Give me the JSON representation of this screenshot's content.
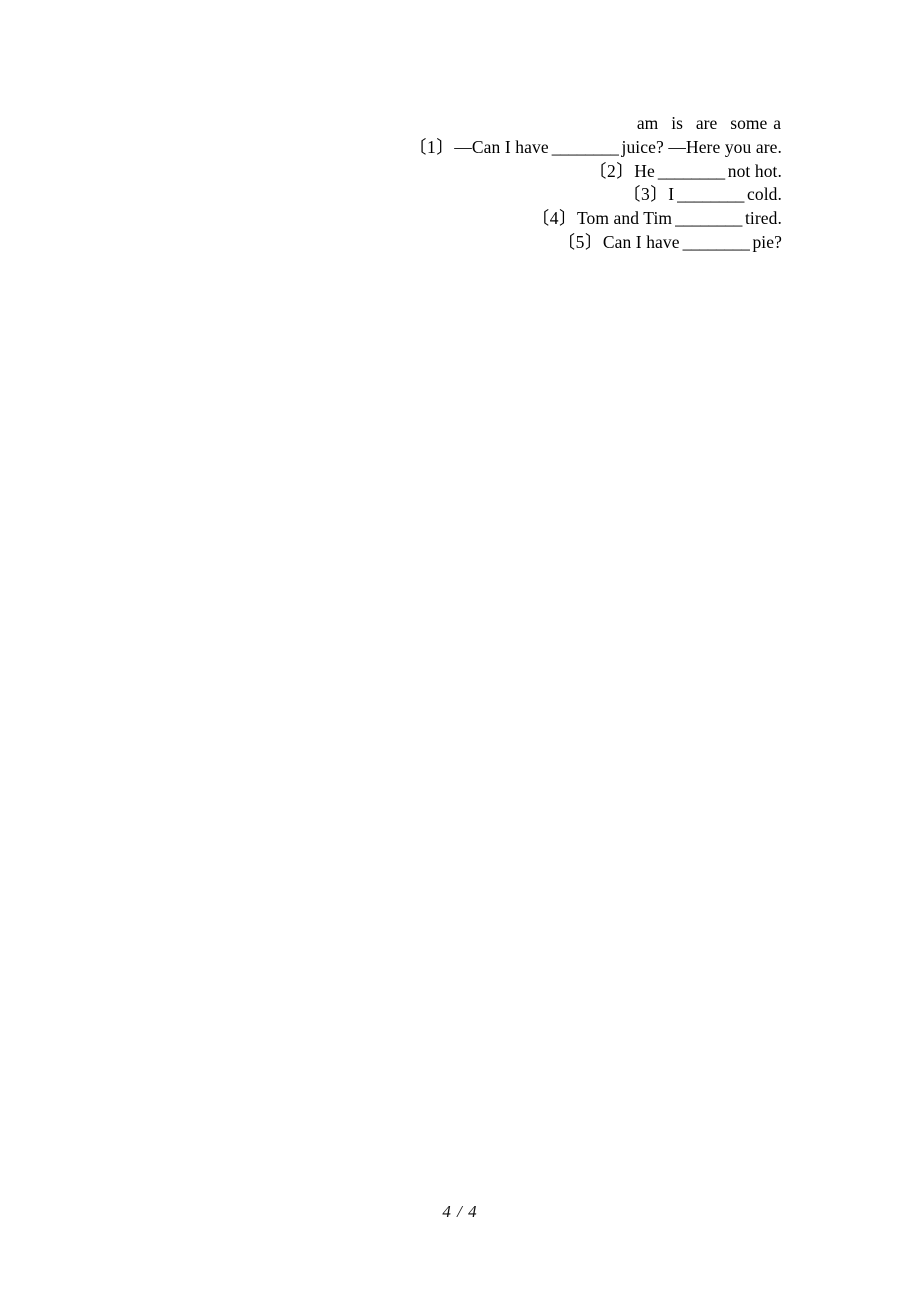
{
  "document": {
    "page_label": "4 / 4",
    "page_number": 4,
    "total_pages": 4
  },
  "word_bank": {
    "words": [
      "am",
      "is",
      "are",
      "some",
      "a"
    ]
  },
  "exercise": {
    "items": [
      {
        "marker": "〔1〕",
        "before": "—Can I have",
        "blank": "________",
        "after": "juice? —Here you are."
      },
      {
        "marker": "〔2〕",
        "before": "He",
        "blank": "________",
        "after": "not hot."
      },
      {
        "marker": "〔3〕",
        "before": "I",
        "blank": "________",
        "after": "cold."
      },
      {
        "marker": "〔4〕",
        "before": "Tom and Tim",
        "blank": "________",
        "after": "tired."
      },
      {
        "marker": "〔5〕",
        "before": "Can I have",
        "blank": "________",
        "after": "pie?"
      }
    ]
  }
}
